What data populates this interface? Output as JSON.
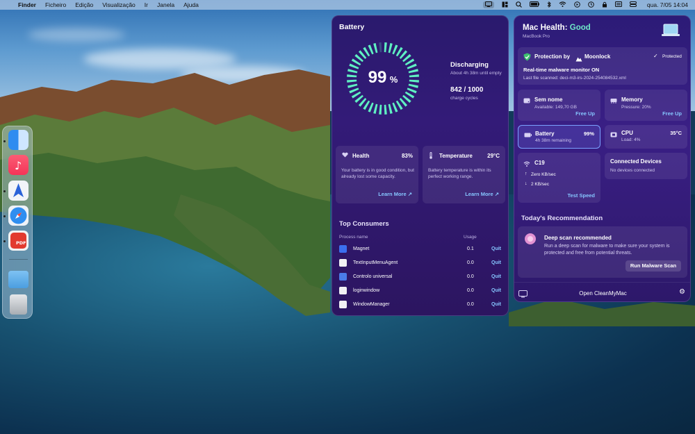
{
  "menubar": {
    "app_name": "Finder",
    "menus": [
      "Ficheiro",
      "Edição",
      "Visualização",
      "Ir",
      "Janela",
      "Ajuda"
    ],
    "clock": "qua. 7/05  14:04"
  },
  "dock": {
    "apps": [
      "finder-icon",
      "music-icon",
      "app-icon",
      "safari-icon",
      "pdf-icon",
      "folder-icon",
      "trash-icon"
    ]
  },
  "battery_panel": {
    "title": "Battery",
    "percent_value": "99",
    "percent_sign": "%",
    "charge_fraction": 0.99,
    "status": "Discharging",
    "status_sub": "About 4h 38m until empty",
    "cycles": "842 / 1000",
    "cycles_label": "charge cycles",
    "health_card": {
      "title": "Health",
      "value": "83%",
      "desc": "Your battery is in good condition, but already lost some capacity.",
      "link": "Learn More ↗"
    },
    "temp_card": {
      "title": "Temperature",
      "value": "29°C",
      "desc": "Battery temperature is within its perfect working range.",
      "link": "Learn More ↗"
    },
    "consumers": {
      "title": "Top Consumers",
      "col_name": "Process name",
      "col_usage": "Usage",
      "rows": [
        {
          "name": "Magnet",
          "usage": "0.1",
          "quit": "Quit"
        },
        {
          "name": "TextInputMenuAgent",
          "usage": "0.0",
          "quit": "Quit"
        },
        {
          "name": "Controlo universal",
          "usage": "0.0",
          "quit": "Quit"
        },
        {
          "name": "loginwindow",
          "usage": "0.0",
          "quit": "Quit"
        },
        {
          "name": "WindowManager",
          "usage": "0.0",
          "quit": "Quit"
        }
      ]
    }
  },
  "health_panel": {
    "title_prefix": "Mac Health: ",
    "title_status": "Good",
    "model": "MacBook Pro",
    "protection": {
      "title": "Protection by",
      "brand": "Moonlock",
      "status": "Protected",
      "monitor": "Real-time malware monitor ON",
      "last_file": "Last file scanned: deci-m3-irs-2024-254084532.xml"
    },
    "disk": {
      "title": "Sem nome",
      "sub": "Available: 149,70 GB",
      "link": "Free Up"
    },
    "memory": {
      "title": "Memory",
      "sub": "Pressure: 20%",
      "link": "Free Up"
    },
    "battery": {
      "title": "Battery",
      "sub": "4h 38m remaining",
      "value": "99%"
    },
    "cpu": {
      "title": "CPU",
      "sub": "Load: 4%",
      "value": "35°C"
    },
    "network": {
      "title": "C19",
      "down": "Zero KB/sec",
      "up": "2 KB/sec",
      "link": "Test Speed"
    },
    "devices": {
      "title": "Connected Devices",
      "sub": "No devices connected"
    },
    "recommendation": {
      "section": "Today's Recommendation",
      "title": "Deep scan recommended",
      "desc": "Run a deep scan for malware to make sure your system is protected and free from potential threats.",
      "button": "Run Malware Scan"
    },
    "footer": "Open CleanMyMac"
  }
}
